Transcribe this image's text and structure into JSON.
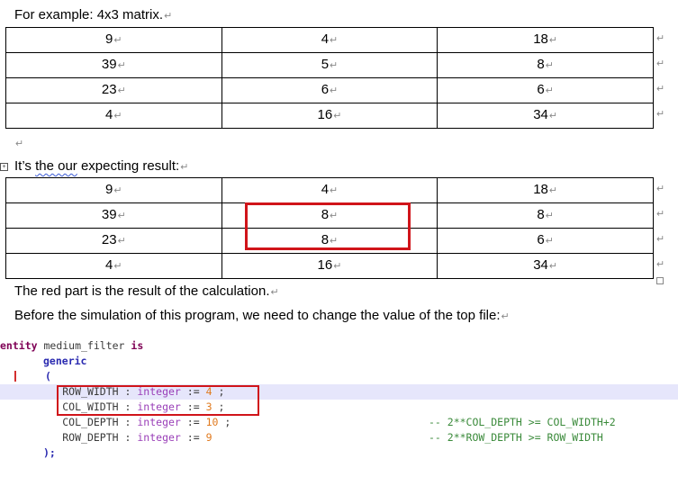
{
  "intro": "For example: 4x3 matrix.",
  "matrix_example": [
    [
      "9",
      "4",
      "18"
    ],
    [
      "39",
      "5",
      "8"
    ],
    [
      "23",
      "6",
      "6"
    ],
    [
      "4",
      "16",
      "34"
    ]
  ],
  "result_heading_prefix": "It’s ",
  "result_heading_squiggle": "the our",
  "result_heading_suffix": " expecting result:",
  "matrix_result": [
    [
      "9",
      "4",
      "18"
    ],
    [
      "39",
      "8",
      "8"
    ],
    [
      "23",
      "8",
      "6"
    ],
    [
      "4",
      "16",
      "34"
    ]
  ],
  "red_note": "The red part is the result of the calculation.",
  "sim_note": "Before the simulation of this program, we need to change the value of the top file:",
  "paragraph_mark": "↵",
  "cell_mark": "↵",
  "code": {
    "line1_kw": "entity",
    "line1_name": " medium_filter ",
    "line1_is": "is",
    "line2": "generic",
    "line3": "(",
    "generics": [
      {
        "name": "ROW_WIDTH",
        "type": "integer",
        "value": "4",
        "end": " ;",
        "comment": ""
      },
      {
        "name": "COL_WIDTH",
        "type": "integer",
        "value": "3",
        "end": " ;",
        "comment": ""
      },
      {
        "name": "COL_DEPTH",
        "type": "integer",
        "value": "10",
        "end": " ;",
        "comment": "-- 2**COL_DEPTH >= COL_WIDTH+2"
      },
      {
        "name": "ROW_DEPTH",
        "type": "integer",
        "value": "9",
        "end": "",
        "comment": "-- 2**ROW_DEPTH >= ROW_WIDTH"
      }
    ],
    "close": ");",
    "colon": ":",
    "assign": ":="
  },
  "colors": {
    "highlight_box": "#d0141a",
    "keyword": "#7f0055",
    "type": "#9a3fb8",
    "number": "#e07a1f",
    "comment": "#3a8a3a"
  }
}
